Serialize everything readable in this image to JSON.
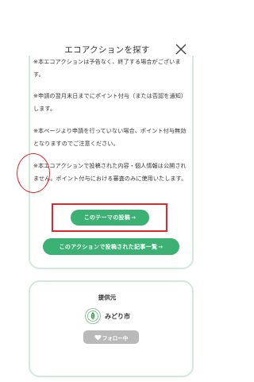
{
  "header": {
    "title": "エコアクションを探す",
    "close_icon": "close-icon"
  },
  "notes": [
    "※本エコアクションは予告なく、終了する場合がございます。",
    "※申請の翌月末日までにポイント付与（または否認を通知）します。",
    "※本ページより申請を行っていない場合、ポイント付与無効となりますのでご注意ください。",
    "※本エコアクションで投稿された内容・個人情報は公開されません。ポイント付与における審査のみに使用いたします。"
  ],
  "buttons": {
    "post_theme": "このテーマの投稿",
    "view_articles": "このアクションで投稿された記事一覧",
    "arrow": "→"
  },
  "provider": {
    "label": "提供元",
    "org_name": "みどり市",
    "logo_icon": "leaf-logo-icon",
    "follow_label": "フォロー中",
    "follow_icon": "heart-icon"
  },
  "colors": {
    "accent_green": "#3bb273",
    "card_border": "#cfe9db",
    "highlight_red": "#e0272b",
    "follow_gray": "#b9b9b9"
  }
}
